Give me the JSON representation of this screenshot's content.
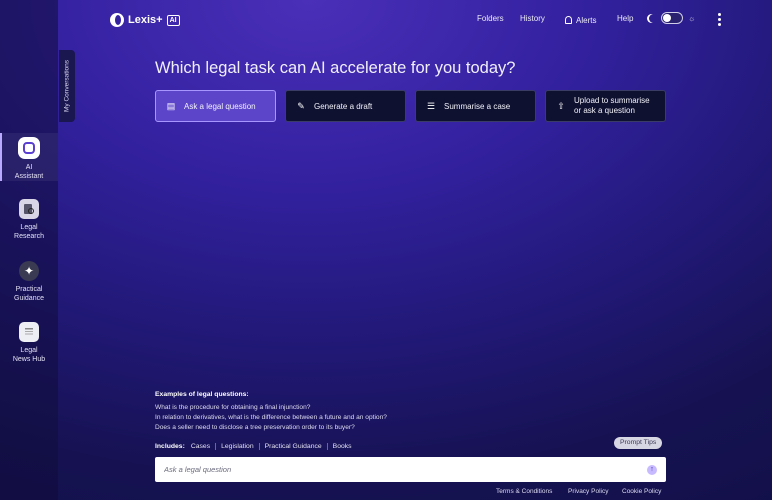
{
  "app": {
    "name": "Lexis+",
    "badge": "AI"
  },
  "header": {
    "nav": [
      "Folders",
      "History",
      "Alerts",
      "Help"
    ]
  },
  "sidebar": {
    "conversations_tab": "My Conversations",
    "items": [
      {
        "label_lines": [
          "AI",
          "Assistant"
        ],
        "icon": "ai-assistant-icon",
        "active": true
      },
      {
        "label_lines": [
          "Legal",
          "Research"
        ],
        "icon": "legal-research-icon",
        "active": false
      },
      {
        "label_lines": [
          "Practical",
          "Guidance"
        ],
        "icon": "practical-guidance-icon",
        "active": false
      },
      {
        "label_lines": [
          "Legal",
          "News Hub"
        ],
        "icon": "news-hub-icon",
        "active": false
      }
    ]
  },
  "main": {
    "headline": "Which legal task can AI accelerate for you today?",
    "tasks": [
      {
        "label": "Ask a legal question",
        "icon": "chat-icon",
        "selected": true
      },
      {
        "label": "Generate a draft",
        "icon": "draft-icon",
        "selected": false
      },
      {
        "label": "Summarise a case",
        "icon": "list-icon",
        "selected": false
      },
      {
        "label_lines": [
          "Upload to summarise",
          "or ask a question"
        ],
        "icon": "upload-icon",
        "selected": false
      }
    ],
    "examples": {
      "title": "Examples of legal questions:",
      "questions": [
        "What is the procedure for obtaining a final injunction?",
        "In relation to derivatives, what is the difference between a future and an option?",
        "Does a seller need to disclose a tree preservation order to its buyer?"
      ]
    },
    "includes": {
      "label": "Includes:",
      "sources": [
        "Cases",
        "Legislation",
        "Practical Guidance",
        "Books"
      ]
    },
    "prompt_tips": "Prompt Tips",
    "input": {
      "placeholder": "Ask a legal question",
      "value": ""
    }
  },
  "footer": {
    "links": [
      "Terms & Conditions",
      "Privacy Policy",
      "Cookie Policy"
    ]
  },
  "colors": {
    "accent": "#5d45c9",
    "background_top": "#4a2fb8",
    "background_bottom": "#12104a"
  }
}
